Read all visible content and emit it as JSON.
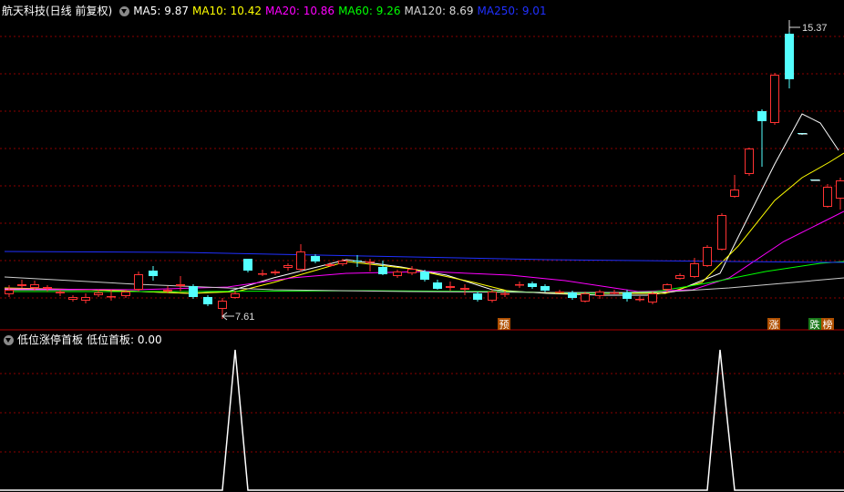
{
  "header": {
    "title": "航天科技(日线 前复权)",
    "ma5_label": "MA5: 9.87",
    "ma10_label": "MA10: 10.42",
    "ma20_label": "MA20: 10.86",
    "ma60_label": "MA60: 9.26",
    "ma120_label": "MA120: 8.69",
    "ma250_label": "MA250: 9.01"
  },
  "indicator": {
    "name": "低位涨停首板",
    "value_label": "低位首板: 0.00"
  },
  "price_high_label": "15.37",
  "price_low_label": "7.61",
  "markers": {
    "pre": "预",
    "zhang": "涨",
    "die": "跌",
    "bang": "榜"
  },
  "colors": {
    "background": "#000000",
    "up": "#ff3232",
    "down": "#54ffff",
    "ma5": "#ffffff",
    "ma10": "#ffff00",
    "ma20": "#ff00ff",
    "ma60": "#00ff00",
    "ma120": "#cccccc",
    "ma250": "#2030ff",
    "grid": "#8b0000"
  },
  "chart_data": {
    "type": "candlestick",
    "candles": [
      [
        10,
        323,
        318,
        313,
        326
      ],
      [
        24,
        314,
        312,
        307,
        316
      ],
      [
        38,
        316,
        312,
        308,
        319
      ],
      [
        52,
        317,
        315,
        313,
        320
      ],
      [
        66,
        322,
        320,
        318,
        325
      ],
      [
        80,
        329,
        326,
        324,
        331
      ],
      [
        94,
        330,
        326,
        322,
        333
      ],
      [
        108,
        324,
        321,
        318,
        326
      ],
      [
        122,
        325,
        325,
        318,
        330
      ],
      [
        138,
        325,
        320,
        318,
        327
      ],
      [
        152,
        318,
        301,
        298,
        320
      ],
      [
        168,
        297,
        303,
        292,
        308
      ],
      [
        184,
        320,
        318,
        314,
        322
      ],
      [
        198,
        314,
        312,
        303,
        320
      ],
      [
        212,
        314,
        326,
        312,
        328
      ],
      [
        228,
        326,
        334,
        324,
        336
      ],
      [
        244,
        339,
        330,
        327,
        350
      ],
      [
        258,
        327,
        322,
        319,
        328
      ],
      [
        272,
        284,
        297,
        284,
        299
      ],
      [
        288,
        300,
        300,
        296,
        303
      ],
      [
        302,
        300,
        298,
        296,
        302
      ],
      [
        316,
        294,
        291,
        289,
        297
      ],
      [
        330,
        296,
        276,
        268,
        298
      ],
      [
        346,
        281,
        287,
        279,
        289
      ],
      [
        362,
        292,
        290,
        288,
        293
      ],
      [
        376,
        290,
        286,
        284,
        292
      ],
      [
        392,
        286,
        287,
        280,
        293
      ],
      [
        406,
        287,
        287,
        284,
        298
      ],
      [
        420,
        293,
        301,
        286,
        302
      ],
      [
        436,
        303,
        298,
        296,
        305
      ],
      [
        452,
        300,
        295,
        292,
        302
      ],
      [
        466,
        298,
        307,
        296,
        309
      ],
      [
        480,
        310,
        317,
        307,
        318
      ],
      [
        494,
        316,
        314,
        309,
        319
      ],
      [
        510,
        318,
        316,
        312,
        324
      ],
      [
        524,
        322,
        329,
        320,
        331
      ],
      [
        540,
        330,
        320,
        318,
        332
      ],
      [
        554,
        322,
        322,
        319,
        326
      ],
      [
        570,
        313,
        312,
        309,
        316
      ],
      [
        584,
        311,
        315,
        309,
        317
      ],
      [
        598,
        314,
        319,
        312,
        321
      ],
      [
        614,
        320,
        320,
        318,
        322
      ],
      [
        628,
        321,
        327,
        319,
        329
      ],
      [
        642,
        331,
        322,
        320,
        332
      ],
      [
        658,
        325,
        320,
        318,
        328
      ],
      [
        674,
        321,
        321,
        318,
        323
      ],
      [
        688,
        321,
        328,
        318,
        331
      ],
      [
        702,
        328,
        328,
        325,
        331
      ],
      [
        716,
        332,
        322,
        320,
        334
      ],
      [
        732,
        318,
        312,
        311,
        321
      ],
      [
        746,
        306,
        302,
        300,
        307
      ],
      [
        762,
        304,
        289,
        283,
        305
      ],
      [
        776,
        292,
        271,
        269,
        293
      ],
      [
        792,
        274,
        236,
        234,
        275
      ],
      [
        806,
        216,
        208,
        192,
        217
      ],
      [
        822,
        191,
        163,
        162,
        193
      ],
      [
        836,
        122,
        133,
        120,
        183
      ],
      [
        850,
        135,
        82,
        80,
        137
      ],
      [
        866,
        37,
        87,
        35,
        97
      ],
      [
        880,
        146,
        147,
        146,
        148
      ],
      [
        894,
        197,
        198,
        197,
        198
      ],
      [
        908,
        227,
        205,
        202,
        228
      ],
      [
        922,
        218,
        198,
        195,
        230
      ]
    ],
    "ma_series": {
      "ma5": [
        [
          5,
          318
        ],
        [
          100,
          318
        ],
        [
          210,
          322
        ],
        [
          250,
          320
        ],
        [
          300,
          305
        ],
        [
          380,
          285
        ],
        [
          440,
          293
        ],
        [
          490,
          302
        ],
        [
          540,
          318
        ],
        [
          600,
          322
        ],
        [
          660,
          324
        ],
        [
          710,
          324
        ],
        [
          740,
          320
        ],
        [
          790,
          300
        ],
        [
          820,
          240
        ],
        [
          850,
          180
        ],
        [
          880,
          125
        ],
        [
          900,
          135
        ],
        [
          920,
          165
        ]
      ],
      "ma10": [
        [
          5,
          316
        ],
        [
          100,
          318
        ],
        [
          210,
          322
        ],
        [
          260,
          320
        ],
        [
          300,
          310
        ],
        [
          380,
          287
        ],
        [
          450,
          295
        ],
        [
          520,
          310
        ],
        [
          560,
          320
        ],
        [
          620,
          322
        ],
        [
          680,
          322
        ],
        [
          730,
          322
        ],
        [
          770,
          310
        ],
        [
          810,
          270
        ],
        [
          850,
          220
        ],
        [
          880,
          195
        ],
        [
          910,
          178
        ],
        [
          926,
          168
        ]
      ],
      "ma20": [
        [
          5,
          317
        ],
        [
          150,
          318
        ],
        [
          250,
          315
        ],
        [
          320,
          305
        ],
        [
          380,
          300
        ],
        [
          470,
          298
        ],
        [
          560,
          302
        ],
        [
          620,
          308
        ],
        [
          700,
          320
        ],
        [
          760,
          318
        ],
        [
          800,
          305
        ],
        [
          860,
          265
        ],
        [
          900,
          245
        ],
        [
          926,
          232
        ]
      ],
      "ma60": [
        [
          5,
          320
        ],
        [
          200,
          320
        ],
        [
          400,
          319
        ],
        [
          550,
          320
        ],
        [
          650,
          322
        ],
        [
          720,
          320
        ],
        [
          780,
          310
        ],
        [
          840,
          298
        ],
        [
          900,
          289
        ],
        [
          926,
          287
        ]
      ],
      "ma120": [
        [
          5,
          304
        ],
        [
          150,
          312
        ],
        [
          300,
          318
        ],
        [
          450,
          320
        ],
        [
          600,
          321
        ],
        [
          720,
          321
        ],
        [
          800,
          316
        ],
        [
          870,
          310
        ],
        [
          926,
          305
        ]
      ],
      "ma250": [
        [
          5,
          276
        ],
        [
          200,
          277
        ],
        [
          400,
          281
        ],
        [
          600,
          285
        ],
        [
          800,
          287
        ],
        [
          926,
          288
        ]
      ]
    },
    "indicator_series": [
      [
        0,
        538
      ],
      [
        244,
        538
      ],
      [
        258,
        384
      ],
      [
        272,
        538
      ],
      [
        776,
        538
      ],
      [
        790,
        384
      ],
      [
        806,
        538
      ],
      [
        926,
        538
      ]
    ],
    "y_range": [
      7.61,
      15.37
    ],
    "grid": true
  }
}
